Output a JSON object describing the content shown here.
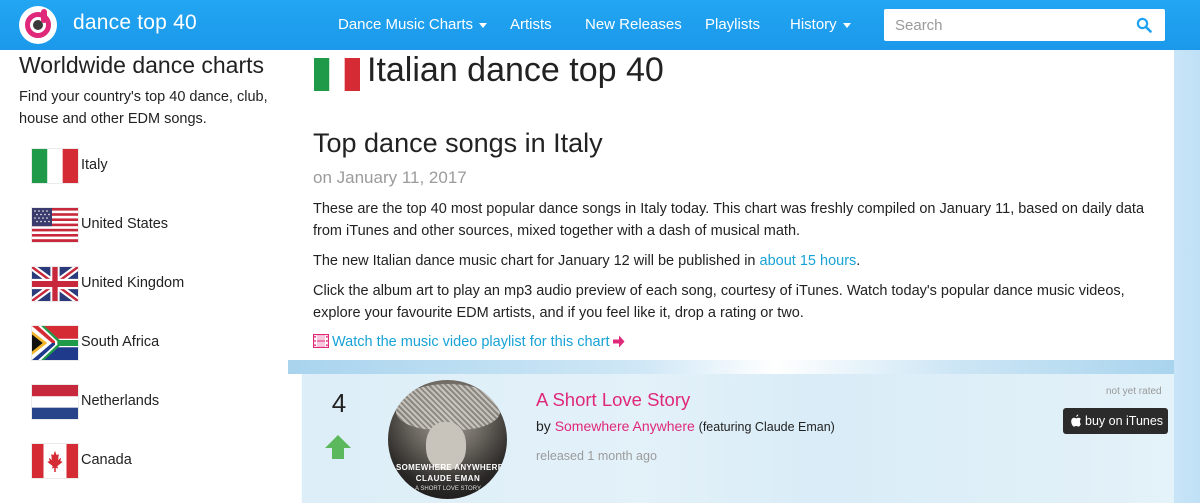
{
  "app": {
    "brand": "dance top 40",
    "colors": {
      "nav": "#1da1f2",
      "accent_pink": "#e0287a",
      "link_blue": "#18a2d6",
      "arrow_green": "#5cb85c"
    }
  },
  "nav": {
    "items": [
      {
        "label": "Dance Music Charts",
        "dropdown": true
      },
      {
        "label": "Artists",
        "dropdown": false
      },
      {
        "label": "New Releases",
        "dropdown": false
      },
      {
        "label": "Playlists",
        "dropdown": false
      },
      {
        "label": "History",
        "dropdown": true
      }
    ],
    "search": {
      "placeholder": "Search",
      "value": "",
      "icon": "search-icon"
    }
  },
  "sidebar": {
    "title": "Worldwide dance charts",
    "description": "Find your country's top 40 dance, club, house and other EDM songs.",
    "countries": [
      {
        "name": "Italy",
        "flag": "italy-flag"
      },
      {
        "name": "United States",
        "flag": "us-flag"
      },
      {
        "name": "United Kingdom",
        "flag": "uk-flag"
      },
      {
        "name": "South Africa",
        "flag": "south-africa-flag"
      },
      {
        "name": "Netherlands",
        "flag": "netherlands-flag"
      },
      {
        "name": "Canada",
        "flag": "canada-flag"
      }
    ]
  },
  "main": {
    "title": "Italian dance top 40",
    "subtitle": "Top dance songs in Italy",
    "date_line": "on January 11, 2017",
    "intro": "These are the top 40 most popular dance songs in Italy today. This chart was freshly compiled on January 11, based on daily data from iTunes and other sources, mixed together with a dash of musical math.",
    "next_chart_prefix": "The new Italian dance music chart for January 12 will be published in ",
    "next_chart_link": "about 15 hours",
    "next_chart_suffix": ".",
    "instructions": "Click the album art to play an mp3 audio preview of each song, courtesy of iTunes. Watch today's popular dance music videos, explore your favourite EDM artists, and if you feel like it, drop a rating or two.",
    "playlist_link": "Watch the music video playlist for this chart"
  },
  "song": {
    "rank": "4",
    "movement": "up",
    "title": "A Short Love Story",
    "by_prefix": "by",
    "artist": "Somewhere Anywhere",
    "featuring": "(featuring Claude Eman)",
    "released": "released 1 month ago",
    "rating_status": "not yet rated",
    "buy_label": "buy on iTunes",
    "cover_text_line1": "SOMEWHERE ANYWHERE",
    "cover_text_line2": "CLAUDE EMAN",
    "cover_text_line3": "A SHORT LOVE STORY"
  }
}
